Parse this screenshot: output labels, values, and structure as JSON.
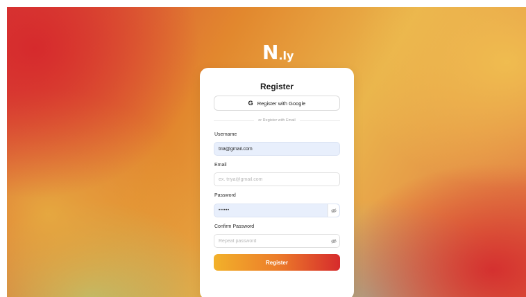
{
  "brand": {
    "logo_main": "N",
    "logo_suffix": ".ly"
  },
  "form": {
    "title": "Register",
    "google_button_label": "Register with Google",
    "divider_text": "or Register with Email",
    "username": {
      "label": "Username",
      "value": "tria@gmail.com"
    },
    "email": {
      "label": "Email",
      "placeholder": "ex. triya@gmail.com"
    },
    "password": {
      "label": "Password",
      "value_masked": "••••••"
    },
    "confirm_password": {
      "label": "Confirm Password",
      "placeholder": "Repeat password"
    },
    "submit_label": "Register"
  },
  "colors": {
    "button_gradient_start": "#f2b12a",
    "button_gradient_end": "#d62b2c",
    "autofill_field_bg": "#e8effc"
  },
  "icons": {
    "google": "google-g-icon",
    "password_toggle": "eye-off-icon"
  }
}
